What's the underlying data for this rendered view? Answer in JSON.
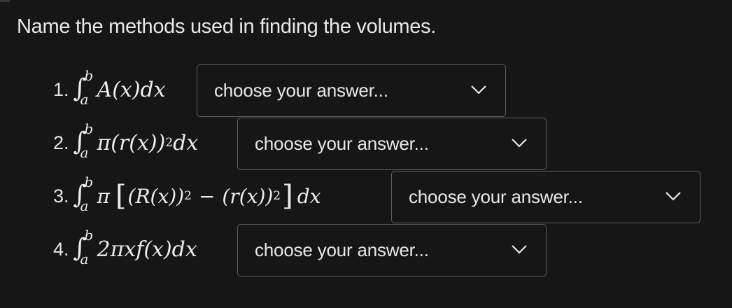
{
  "prompt": "Name the methods used in finding the volumes.",
  "items": [
    {
      "number": "1.",
      "integral": {
        "upper": "b",
        "lower": "a"
      },
      "expression": "A(x)dx",
      "select": {
        "value": "choose your answer...",
        "icon": "chevron-down-icon"
      }
    },
    {
      "number": "2.",
      "integral": {
        "upper": "b",
        "lower": "a"
      },
      "expression_parts": {
        "pre": "π(r(x))",
        "power": "2",
        "post": "dx"
      },
      "select": {
        "value": "choose your answer...",
        "icon": "chevron-down-icon"
      }
    },
    {
      "number": "3.",
      "integral": {
        "upper": "b",
        "lower": "a"
      },
      "expression_parts": {
        "pi": "π",
        "open_bracket": "[",
        "term1": "(R(x))",
        "power1": "2",
        "minus": "−",
        "term2": "(r(x))",
        "power2": "2",
        "close_bracket": "]",
        "dx": "dx"
      },
      "select": {
        "value": "choose your answer...",
        "icon": "chevron-down-icon"
      }
    },
    {
      "number": "4.",
      "integral": {
        "upper": "b",
        "lower": "a"
      },
      "expression": "2πxf(x)dx",
      "select": {
        "value": "choose your answer...",
        "icon": "chevron-down-icon"
      }
    }
  ],
  "colors": {
    "background": "#161616",
    "text": "#e8e8e8",
    "select_border": "#5e5e5e"
  }
}
